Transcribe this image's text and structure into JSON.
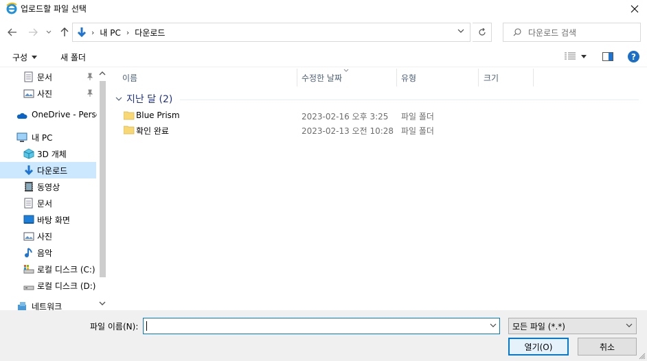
{
  "window": {
    "title": "업로드할 파일 선택"
  },
  "address": {
    "crumbs": [
      "내 PC",
      "다운로드"
    ],
    "search_placeholder": "다운로드 검색"
  },
  "toolbar": {
    "organize": "구성",
    "new_folder": "새 폴더",
    "help": "?"
  },
  "sidebar": {
    "items": [
      {
        "label": "문서",
        "icon": "document-icon",
        "pinned": true
      },
      {
        "label": "사진",
        "icon": "pictures-icon",
        "pinned": true
      },
      {
        "label": "OneDrive - Person",
        "icon": "onedrive-cloud-icon"
      },
      {
        "label": "내 PC",
        "icon": "pc-icon"
      },
      {
        "label": "3D 개체",
        "icon": "3d-objects-icon"
      },
      {
        "label": "다운로드",
        "icon": "download-icon",
        "selected": true
      },
      {
        "label": "동영상",
        "icon": "video-icon"
      },
      {
        "label": "문서",
        "icon": "document-icon"
      },
      {
        "label": "바탕 화면",
        "icon": "desktop-icon"
      },
      {
        "label": "사진",
        "icon": "pictures-icon"
      },
      {
        "label": "음악",
        "icon": "music-icon"
      },
      {
        "label": "로컬 디스크 (C:)",
        "icon": "system-drive-icon"
      },
      {
        "label": "로컬 디스크 (D:)",
        "icon": "drive-icon"
      },
      {
        "label": "네트워크",
        "icon": "network-icon"
      }
    ]
  },
  "columns": {
    "name": "이름",
    "modified": "수정한 날짜",
    "type": "유형",
    "size": "크기"
  },
  "group": {
    "label": "지난 달 (2)"
  },
  "files": [
    {
      "name": "Blue Prism",
      "modified": "2023-02-16 오후 3:25",
      "type": "파일 폴더"
    },
    {
      "name": "확인 완료",
      "modified": "2023-02-13 오전 10:28",
      "type": "파일 폴더"
    }
  ],
  "bottom": {
    "filename_label": "파일 이름(N):",
    "filename_value": "",
    "filter": "모든 파일 (*.*)",
    "open_button": "열기(O)",
    "cancel_button": "취소"
  },
  "colors": {
    "selection": "#cce8ff",
    "accent": "#0078d7",
    "group_text": "#1e3287",
    "folder": "#f8d775"
  }
}
